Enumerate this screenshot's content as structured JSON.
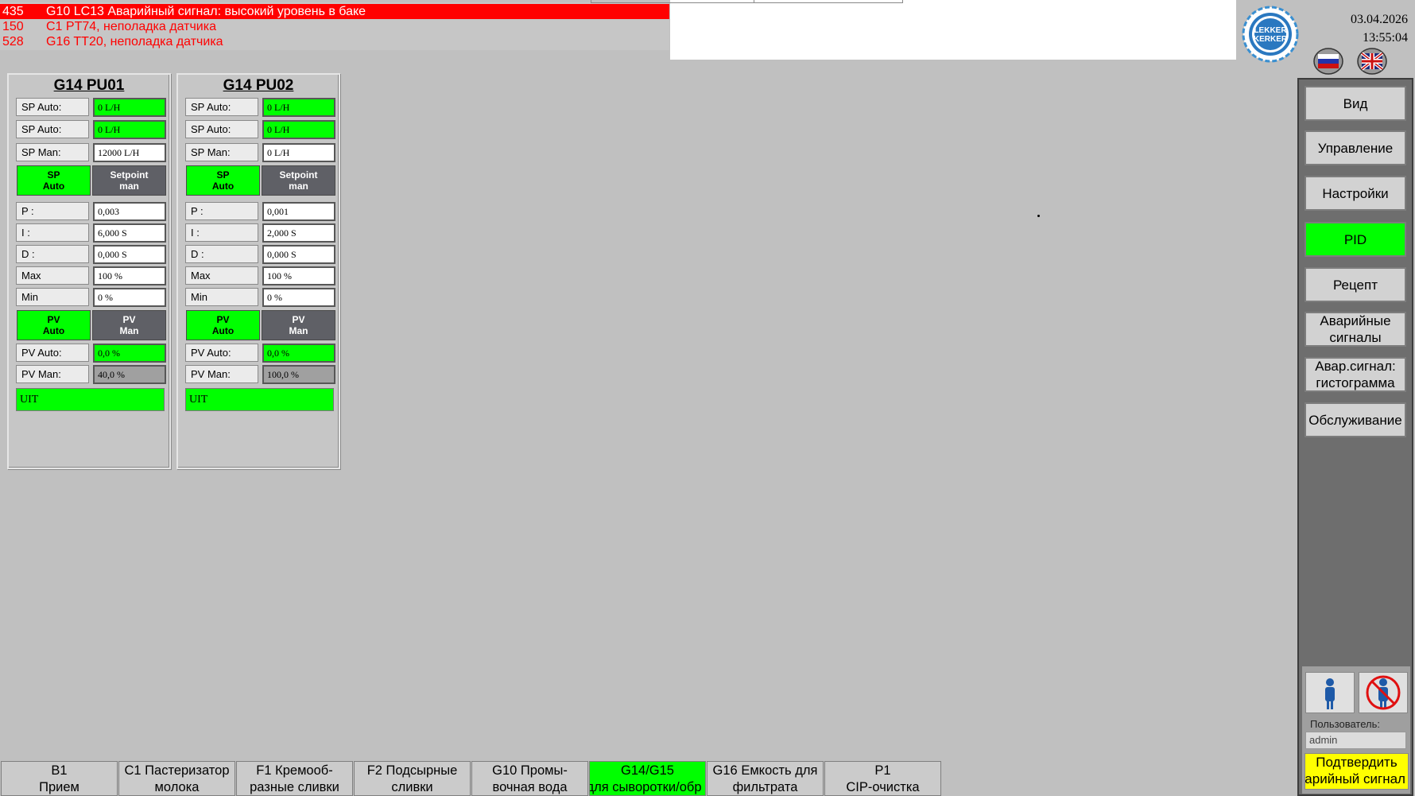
{
  "alarms": [
    {
      "number": "435",
      "text": "G10 LC13 Аварийный сигнал: высокий уровень в баке",
      "state": "active"
    },
    {
      "number": "150",
      "text": "C1 PT74, неполадка датчика",
      "state": "passive"
    },
    {
      "number": "528",
      "text": "G16 TT20, неполадка датчика",
      "state": "passive"
    }
  ],
  "header": {
    "logo_text_top": "LEKKER",
    "logo_text_bottom": "KERKER",
    "date": "03.04.2026",
    "time": "13:55:04",
    "language_flags": [
      "russia-flag-icon",
      "uk-flag-icon"
    ]
  },
  "sidebar": {
    "items": [
      {
        "label": "Вид",
        "active": false
      },
      {
        "label": "Управление",
        "active": false
      },
      {
        "label": "Настройки",
        "active": false
      },
      {
        "label": "PID",
        "active": true
      },
      {
        "label": "Рецепт",
        "active": false
      },
      {
        "label": "Аварийные сигналы",
        "active": false
      },
      {
        "label": "Авар.сигнал: гистограмма",
        "active": false
      },
      {
        "label": "Обслуживание",
        "active": false
      }
    ],
    "user_label": "Пользователь:",
    "user_value": "admin",
    "ack_label_line1": "Подтвердить",
    "ack_label_line2": "аварийный сигнал"
  },
  "panels": [
    {
      "title": "G14 PU01",
      "sp_auto_1_label": "SP Auto:",
      "sp_auto_1_value": "0 L/H",
      "sp_auto_2_label": "SP Auto:",
      "sp_auto_2_value": "0 L/H",
      "sp_man_label": "SP Man:",
      "sp_man_value": "12000 L/H",
      "btn_sp_auto_1": "SP",
      "btn_sp_auto_2": "Auto",
      "btn_setpoint_man_1": "Setpoint",
      "btn_setpoint_man_2": "man",
      "p_label": "P :",
      "p_value": "0,003",
      "i_label": "I :",
      "i_value": "6,000 S",
      "d_label": "D :",
      "d_value": "0,000 S",
      "max_label": "Max",
      "max_value": "100 %",
      "min_label": "Min",
      "min_value": "0 %",
      "btn_pv_auto_1": "PV",
      "btn_pv_auto_2": "Auto",
      "btn_pv_man_1": "PV",
      "btn_pv_man_2": "Man",
      "pv_auto_label": "PV Auto:",
      "pv_auto_value": "0,0 %",
      "pv_man_label": "PV Man:",
      "pv_man_value": "40,0 %",
      "uit": "UIT"
    },
    {
      "title": "G14 PU02",
      "sp_auto_1_label": "SP Auto:",
      "sp_auto_1_value": "0 L/H",
      "sp_auto_2_label": "SP Auto:",
      "sp_auto_2_value": "0 L/H",
      "sp_man_label": "SP Man:",
      "sp_man_value": "0 L/H",
      "btn_sp_auto_1": "SP",
      "btn_sp_auto_2": "Auto",
      "btn_setpoint_man_1": "Setpoint",
      "btn_setpoint_man_2": "man",
      "p_label": "P :",
      "p_value": "0,001",
      "i_label": "I :",
      "i_value": "2,000 S",
      "d_label": "D :",
      "d_value": "0,000 S",
      "max_label": "Max",
      "max_value": "100 %",
      "min_label": "Min",
      "min_value": "0 %",
      "btn_pv_auto_1": "PV",
      "btn_pv_auto_2": "Auto",
      "btn_pv_man_1": "PV",
      "btn_pv_man_2": "Man",
      "pv_auto_label": "PV Auto:",
      "pv_auto_value": "0,0 %",
      "pv_man_label": "PV Man:",
      "pv_man_value": "100,0 %",
      "uit": "UIT"
    }
  ],
  "bottom_tabs": [
    {
      "line1": "B1",
      "line2": "Прием",
      "active": false
    },
    {
      "line1": "C1 Пастеризатор",
      "line2": "молока",
      "active": false
    },
    {
      "line1": "F1 Кремооб-",
      "line2": "разные сливки",
      "active": false
    },
    {
      "line1": "F2 Подсырные",
      "line2": "сливки",
      "active": false
    },
    {
      "line1": "G10 Промы-",
      "line2": "вочная вода",
      "active": false
    },
    {
      "line1": "G14/G15",
      "line2": "для сыворотки/обр",
      "active": true
    },
    {
      "line1": "G16 Емкость для",
      "line2": "фильтрата",
      "active": false
    },
    {
      "line1": "P1",
      "line2": "CIP-очистка",
      "active": false
    }
  ],
  "colors": {
    "background": "#c0c0c0",
    "active_green": "#00ff00",
    "alarm_red": "#ff0000",
    "ack_yellow": "#ffff00"
  }
}
